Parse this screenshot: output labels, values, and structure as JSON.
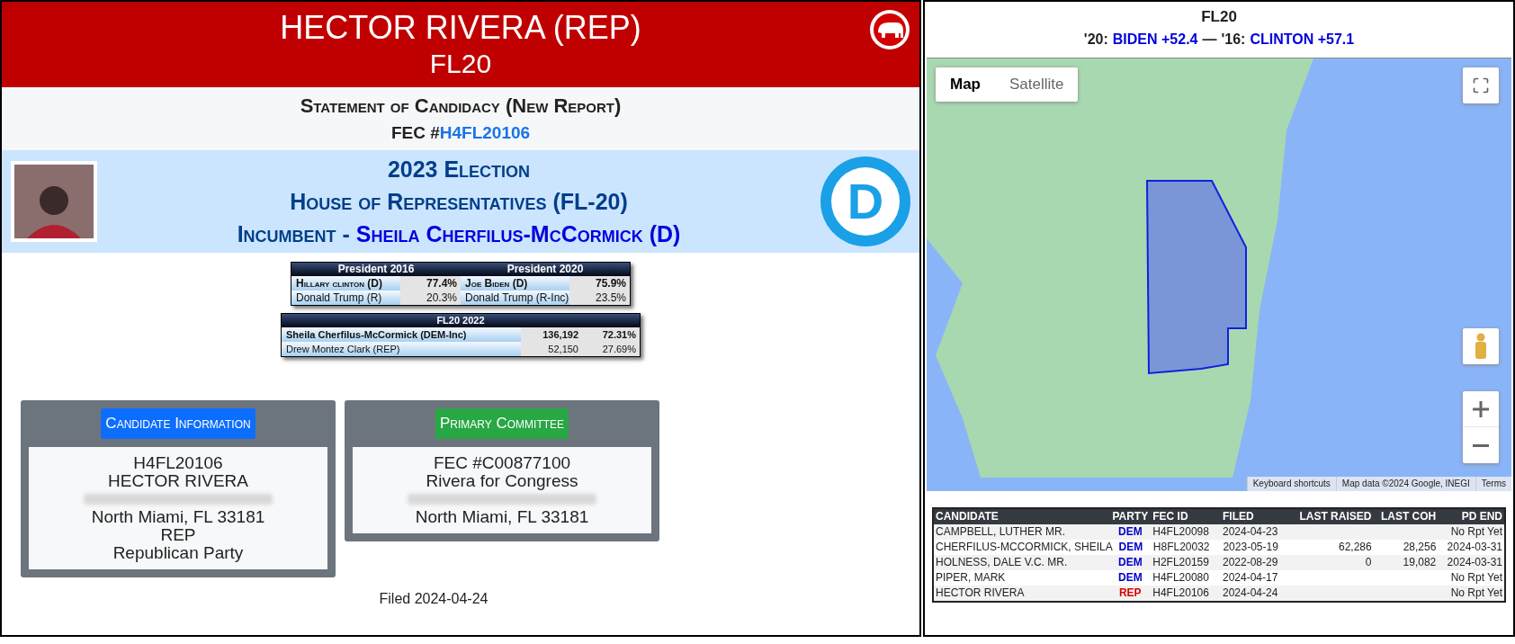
{
  "header": {
    "title": "HECTOR RIVERA (REP)",
    "district": "FL20"
  },
  "report": {
    "title": "Statement of Candidacy (New Report)",
    "fec_label": "FEC #",
    "fec_id": "H4FL20106"
  },
  "election": {
    "title": "2023 Election",
    "chamber": "House of Representatives (FL-20)",
    "incumbent_label": "Incumbent - ",
    "incumbent": "Sheila Cherfilus-McCormick (D)",
    "party_logo": "D"
  },
  "presidential": {
    "columns": [
      "President 2016",
      "President 2020"
    ],
    "rows": [
      {
        "cells": [
          "Hillary clinton (D)",
          "77.4%",
          "Joe Biden (D)",
          "75.9%"
        ],
        "small_caps": true
      },
      {
        "cells": [
          "Donald Trump (R)",
          "20.3%",
          "Donald Trump (R-Inc)",
          "23.5%"
        ],
        "small_caps": false
      }
    ]
  },
  "previous": {
    "title": "FL20 2022",
    "rows": [
      {
        "name": "Sheila Cherfilus-McCormick (DEM-Inc)",
        "votes": "136,192",
        "pct": "72.31%",
        "winner": true
      },
      {
        "name": "Drew Montez Clark (REP)",
        "votes": "52,150",
        "pct": "27.69%",
        "winner": false
      }
    ]
  },
  "cards": [
    {
      "title": "Candidate Information",
      "color": "#0d6efd",
      "lines": [
        {
          "kind": "text",
          "text": "H4FL20106"
        },
        {
          "kind": "text",
          "text": "HECTOR RIVERA"
        },
        {
          "kind": "blurred"
        },
        {
          "kind": "text",
          "text": "North Miami, FL 33181"
        },
        {
          "kind": "text",
          "text": "REP"
        },
        {
          "kind": "text",
          "text": "Republican Party"
        }
      ]
    },
    {
      "title": "Primary Committee",
      "color": "#28a745",
      "lines": [
        {
          "kind": "text",
          "text": "FEC #C00877100"
        },
        {
          "kind": "text",
          "text": "Rivera for Congress"
        },
        {
          "kind": "blurred"
        },
        {
          "kind": "text",
          "text": "North Miami, FL 33181"
        }
      ]
    }
  ],
  "filed": "Filed 2024-04-24",
  "district_panel": {
    "title": "FL20",
    "results": [
      {
        "label": "'20:",
        "result": "BIDEN +52.4"
      },
      {
        "label": "'16:",
        "result": "CLINTON +57.1"
      }
    ],
    "separator": "—"
  },
  "map": {
    "type_buttons": [
      {
        "label": "Map",
        "selected": true
      },
      {
        "label": "Satellite",
        "selected": false
      }
    ],
    "attribution": [
      "Keyboard shortcuts",
      "Map data ©2024 Google, INEGI",
      "Terms"
    ]
  },
  "candidates_table": {
    "columns": [
      "CANDIDATE",
      "PARTY",
      "FEC ID",
      "FILED",
      "LAST RAISED",
      "LAST COH",
      "PD END"
    ],
    "rows": [
      {
        "cells": [
          "CAMPBELL, LUTHER MR.",
          "DEM",
          "H4FL20098",
          "2024-04-23",
          "",
          "",
          "No Rpt Yet"
        ],
        "color": "#0000cc"
      },
      {
        "cells": [
          "CHERFILUS-MCCORMICK, SHEILA",
          "DEM",
          "H8FL20032",
          "2023-05-19",
          "62,286",
          "28,256",
          "2024-03-31"
        ],
        "color": "#0000cc"
      },
      {
        "cells": [
          "HOLNESS, DALE V.C. MR.",
          "DEM",
          "H2FL20159",
          "2022-08-29",
          "0",
          "19,082",
          "2024-03-31"
        ],
        "color": "#0000cc"
      },
      {
        "cells": [
          "PIPER, MARK",
          "DEM",
          "H4FL20080",
          "2024-04-17",
          "",
          "",
          "No Rpt Yet"
        ],
        "color": "#0000cc"
      },
      {
        "cells": [
          "HECTOR RIVERA",
          "REP",
          "H4FL20106",
          "2024-04-24",
          "",
          "",
          "No Rpt Yet"
        ],
        "color": "#dd0000"
      }
    ]
  }
}
